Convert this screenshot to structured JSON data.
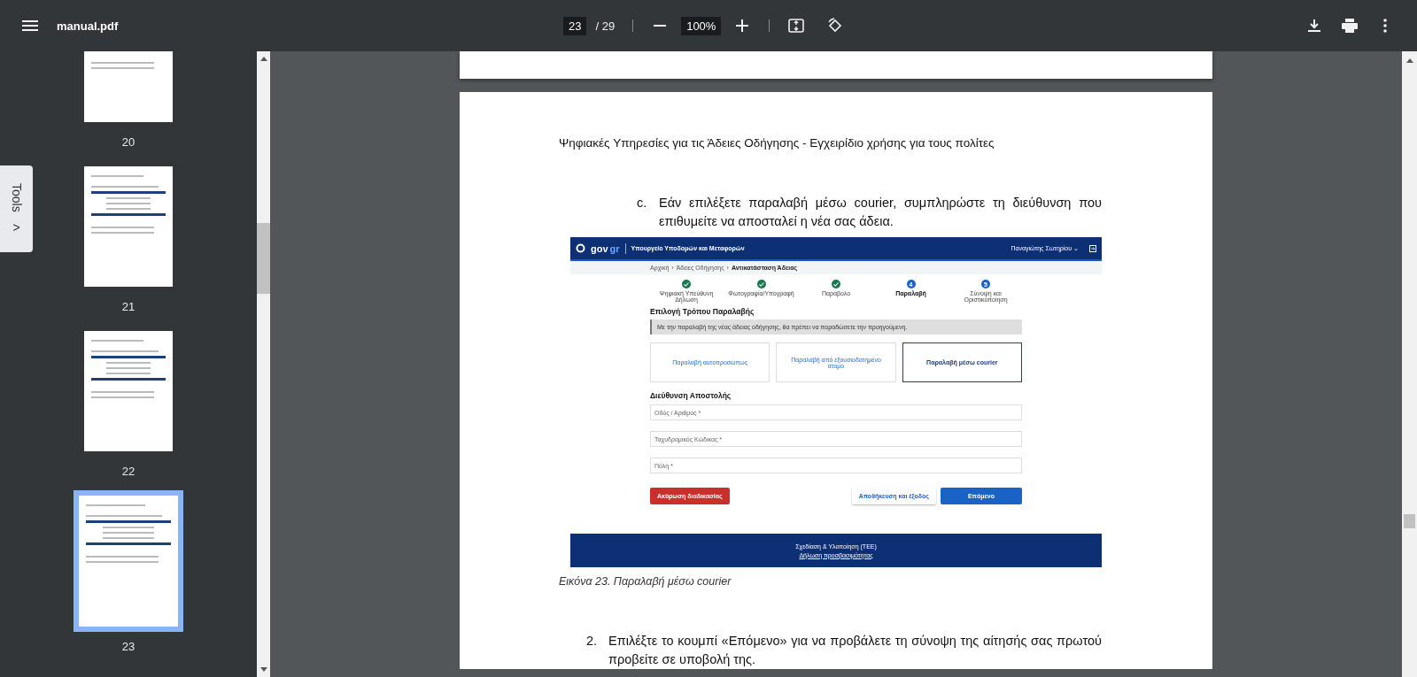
{
  "toolbar": {
    "file_name": "manual.pdf",
    "page_current": "23",
    "page_total": "/ 29",
    "zoom": "100%"
  },
  "sidebar": {
    "thumbnails": [
      {
        "label": "20",
        "selected": false
      },
      {
        "label": "21",
        "selected": false
      },
      {
        "label": "22",
        "selected": false
      },
      {
        "label": "23",
        "selected": true
      }
    ]
  },
  "tools_tab": {
    "label": "Tools",
    "arrow": ">"
  },
  "document": {
    "header": "Ψηφιακές Υπηρεσίες για τις Άδειες Οδήγησης - Εγχειρίδιο χρήσης για τους πολίτες",
    "step_c": {
      "marker": "c.",
      "text": "Εάν επιλέξετε παραλαβή μέσω courier, συμπληρώστε τη διεύθυνση που επιθυμείτε να αποσταλεί η νέα σας άδεια."
    },
    "figure": {
      "brand": "gov",
      "brand_accent": "gr",
      "ministry": "Υπουργείο Υποδομών και Μεταφορών",
      "user": "Παναγιώτης Σωτηρίου",
      "user_caret": "⌄",
      "breadcrumb": [
        "Αρχική",
        "Άδειες Οδήγησης",
        "Αντικατάσταση Άδειας"
      ],
      "breadcrumb_separator": "›",
      "steps": [
        {
          "label": "Ψηφιακή Υπεύθυνη Δήλωση",
          "completed": true,
          "current": false
        },
        {
          "label": "Φωτογραφία/Υπογραφή",
          "completed": true,
          "current": false
        },
        {
          "label": "Παράβολο",
          "completed": true,
          "current": false
        },
        {
          "number": "4",
          "label": "Παραλαβή",
          "completed": false,
          "current": true
        },
        {
          "number": "5",
          "label": "Σύνοψη και Οριστικοποίηση",
          "completed": false,
          "current": false
        }
      ],
      "section_title": "Επιλογή Τρόπου Παραλαβής",
      "notice": "Με την παραλαβή της νέας άδειας οδήγησης, θα πρέπει να παραδώσετε την προηγούμενη.",
      "options": [
        {
          "label": "Παραλαβή αυτοπροσώπως",
          "selected": false
        },
        {
          "label": "Παραλαβή από εξουσιοδοτημένο άτομο",
          "selected": false
        },
        {
          "label": "Παραλαβή μέσω courier",
          "selected": true
        }
      ],
      "address_title": "Διεύθυνση Αποστολής",
      "fields": [
        {
          "placeholder": "Οδός / Αριθμός *"
        },
        {
          "placeholder": "Ταχυδρομικός Κώδικας *"
        },
        {
          "placeholder": "Πόλη *"
        }
      ],
      "buttons": [
        {
          "label": "Ακύρωση διαδικασίας",
          "kind": "danger"
        },
        {
          "label": "Αποθήκευση και έξοδος",
          "kind": "secondary"
        },
        {
          "label": "Επόμενο",
          "kind": "primary"
        }
      ],
      "footer": [
        "Σχεδίαση & Υλοποίηση (ΤΕΕ)",
        "Δήλωση προσβασιμότητας"
      ]
    },
    "caption": "Εικόνα 23. Παραλαβή μέσω courier",
    "step_2": {
      "marker": "2.",
      "text": "Επιλέξτε το κουμπί «Επόμενο» για να προβάλετε τη σύνοψη της αίτησής σας πρωτού προβείτε σε υποβολή της."
    }
  }
}
